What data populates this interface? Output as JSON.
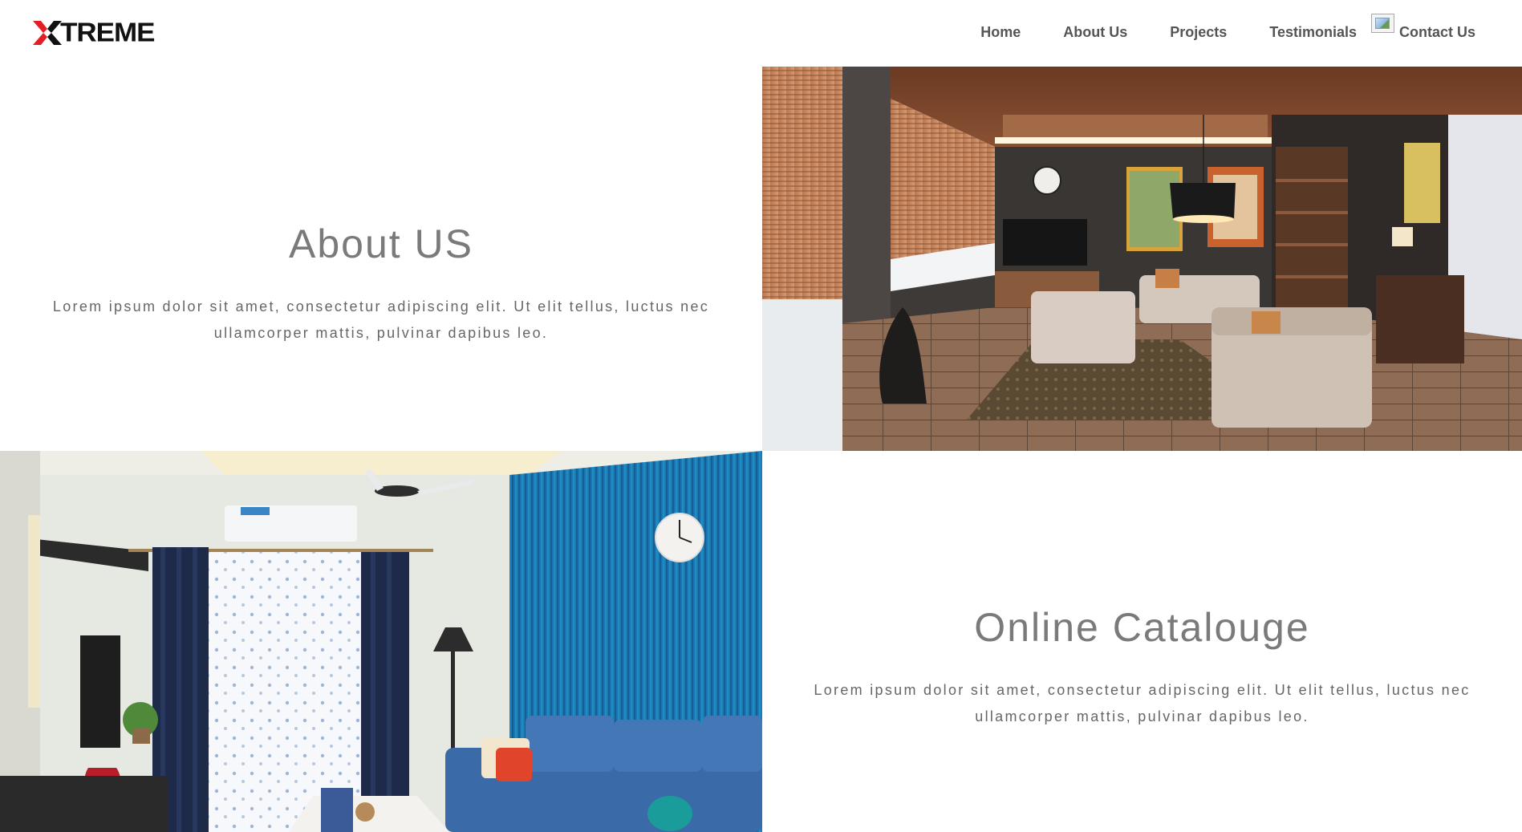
{
  "header": {
    "logo": {
      "accent_color": "#e31e24",
      "text_color": "#111111",
      "text": "TREME"
    },
    "nav": [
      {
        "label": "Home"
      },
      {
        "label": "About Us"
      },
      {
        "label": "Projects"
      },
      {
        "label": "Testimonials"
      },
      {
        "label": "Contact Us"
      }
    ],
    "broken_image_icon": "broken-image-icon"
  },
  "about": {
    "title": "About US",
    "body": "Lorem ipsum dolor sit amet, consectetur adipiscing elit. Ut elit tellus, luctus nec ullamcorper mattis, pulvinar dapibus leo."
  },
  "catalogue": {
    "title": "Online Catalouge",
    "body": "Lorem ipsum dolor sit amet, consectetur adipiscing elit. Ut elit tellus, luctus nec ullamcorper mattis, pulvinar dapibus leo."
  },
  "colors": {
    "heading": "#7a7a7a",
    "body_text": "#666666",
    "nav_text": "#555555",
    "background": "#ffffff"
  }
}
